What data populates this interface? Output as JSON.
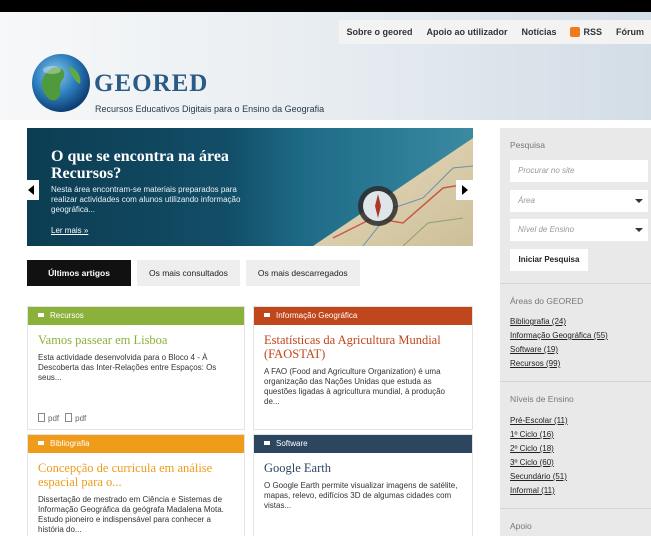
{
  "nav": {
    "items": [
      "Sobre o geored",
      "Apoio ao utilizador",
      "Notícias",
      "RSS",
      "Fórum"
    ]
  },
  "brand": {
    "name": "GEORED",
    "tagline": "Recursos Educativos Digitais para o Ensino da Geografia"
  },
  "banner": {
    "title": "O que se encontra na área Recursos?",
    "text": "Nesta área encontram-se materiais preparados para realizar actividades com alunos utilizando informação geográfica...",
    "more": "Ler mais »"
  },
  "tabs": [
    "Últimos artigos",
    "Os mais consultados",
    "Os mais descarregados"
  ],
  "cards": [
    {
      "category": "Recursos",
      "color": "#8bb13a",
      "title": "Vamos passear em Lisboa",
      "text": "Esta actividade desenvolvida para o Bloco 4 - À Descoberta das Inter-Relações entre Espaços: Os seus...",
      "files": [
        "pdf",
        "pdf"
      ]
    },
    {
      "category": "Informação Geográfica",
      "color": "#c0461c",
      "title": "Estatísticas da Agricultura Mundial (FAOSTAT)",
      "text": "A FAO (Food and Agriculture Organization) é uma organização das Nações Unidas que estuda as questões ligadas à agricultura mundial, à produção de..."
    },
    {
      "category": "Bibliografia",
      "color": "#ef9c1b",
      "title": "Concepção de curricula em análise espacial para o...",
      "text": "Dissertação de mestrado em Ciência e Sistemas de Informação Geográfica da geógrafa Madalena Mota. Estudo pioneiro e indispensável para conhecer a história do..."
    },
    {
      "category": "Software",
      "color": "#2c4660",
      "title": "Google Earth",
      "text": "O Google Earth permite visualizar imagens de satélite, mapas, relevo, edifícios 3D de algumas cidades com vistas..."
    }
  ],
  "sidebar": {
    "search_heading": "Pesquisa",
    "search_placeholder": "Procurar no site",
    "area_placeholder": "Área",
    "level_placeholder": "Nível de Ensino",
    "search_button": "Iniciar Pesquisa",
    "areas_heading": "Áreas do GEORED",
    "areas": [
      "Bibliografia (24)",
      "Informação Geográfica (55)",
      "Software (19)",
      "Recursos (99)"
    ],
    "levels_heading": "Níveis de Ensino",
    "levels": [
      "Pré-Escolar (11)",
      "1º Ciclo (16)",
      "2º Ciclo (18)",
      "3º Ciclo (60)",
      "Secundário (51)",
      "Informal (11)"
    ],
    "support_heading": "Apoio"
  }
}
